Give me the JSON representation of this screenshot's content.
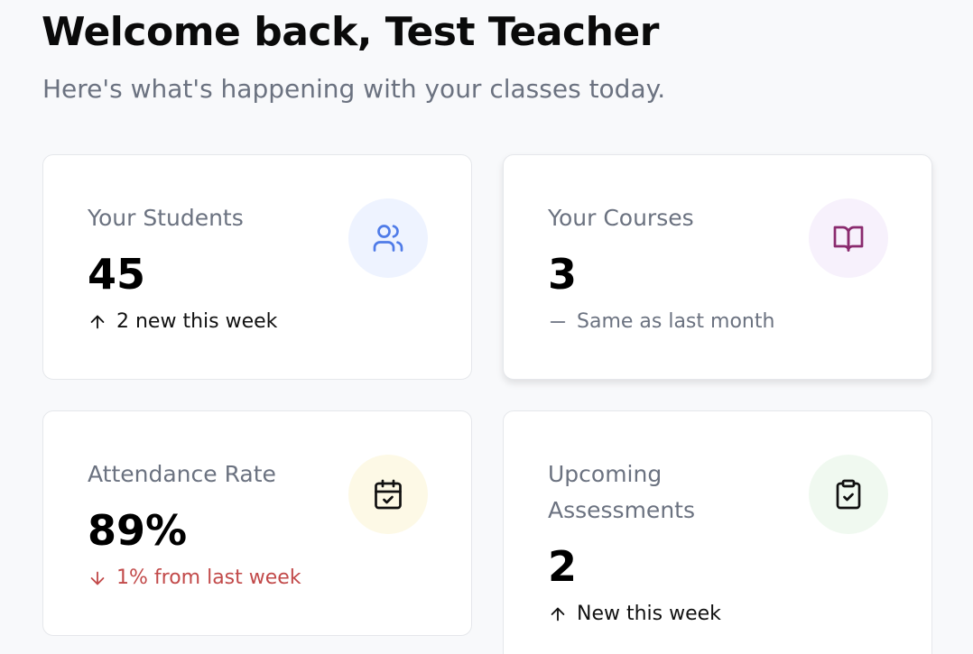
{
  "header": {
    "title": "Welcome back, Test Teacher",
    "subtitle": "Here's what's happening with your classes today."
  },
  "cards": [
    {
      "label": "Your Students",
      "value": "45",
      "trend": "2 new this week",
      "trend_direction": "up",
      "icon": "users-icon",
      "icon_color": "#4f7be8",
      "icon_bg": "#eef3ff"
    },
    {
      "label": "Your Courses",
      "value": "3",
      "trend": "Same as last month",
      "trend_direction": "neutral",
      "icon": "book-open-icon",
      "icon_color": "#8a2a6e",
      "icon_bg": "#f7f1fc"
    },
    {
      "label": "Attendance Rate",
      "value": "89%",
      "trend": "1% from last week",
      "trend_direction": "down",
      "icon": "calendar-check-icon",
      "icon_color": "#111111",
      "icon_bg": "#fdf9e6"
    },
    {
      "label": "Upcoming Assessments",
      "value": "2",
      "trend": "New this week",
      "trend_direction": "up",
      "icon": "clipboard-check-icon",
      "icon_color": "#111111",
      "icon_bg": "#f0f9f0"
    }
  ],
  "colors": {
    "background": "#f8f9fb",
    "muted_text": "#6b7280",
    "negative": "#c24a4a"
  }
}
